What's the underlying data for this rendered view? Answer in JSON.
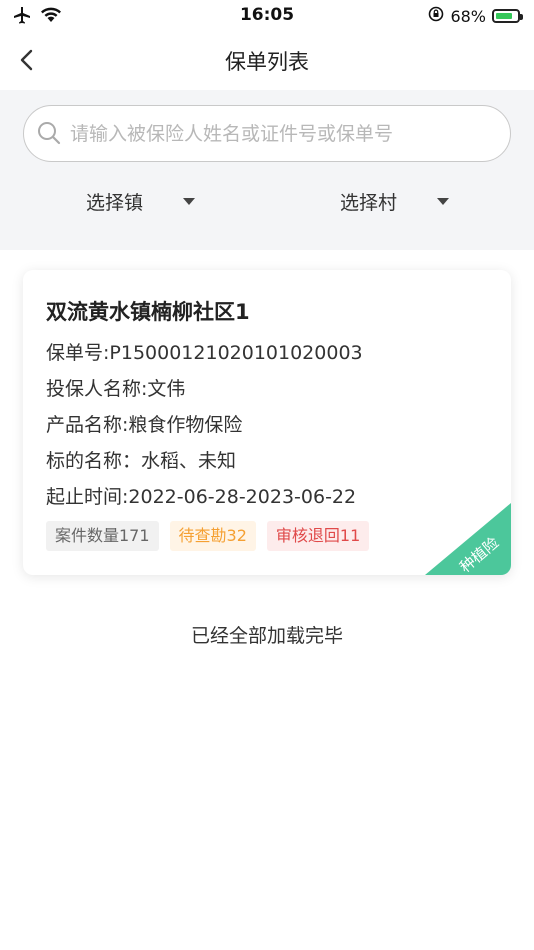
{
  "status_bar": {
    "time": "16:05",
    "battery": "68%"
  },
  "nav": {
    "title": "保单列表"
  },
  "search": {
    "placeholder": "请输入被保险人姓名或证件号或保单号"
  },
  "filters": [
    {
      "label": "选择镇"
    },
    {
      "label": "选择村"
    }
  ],
  "card": {
    "title": "双流黄水镇楠柳社区1",
    "policy_no": "保单号:P15000121020101020003",
    "insured": "投保人名称:文伟",
    "product": "产品名称:粮食作物保险",
    "subject": "标的名称：水稻、未知",
    "period": "起止时间:2022-06-28-2023-06-22",
    "tags": [
      {
        "label": "案件数量171"
      },
      {
        "label": "待查勘32"
      },
      {
        "label": "审核退回11"
      }
    ],
    "ribbon": "种植险"
  },
  "footer": {
    "text": "已经全部加载完毕"
  }
}
